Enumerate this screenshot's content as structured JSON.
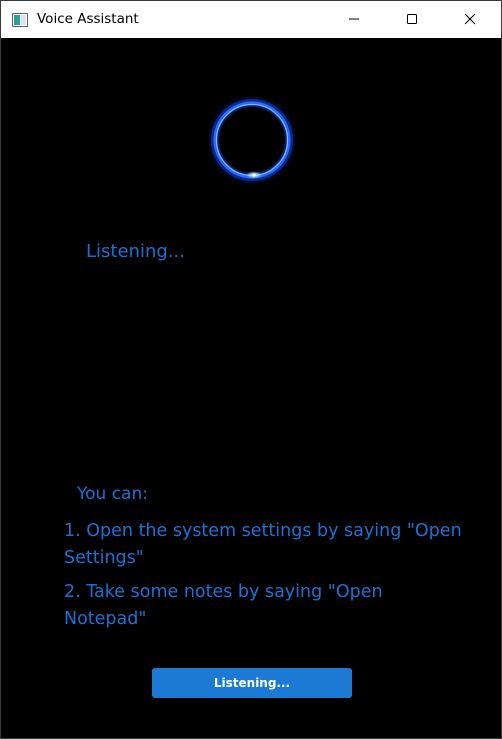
{
  "window": {
    "title": "Voice Assistant",
    "controls": {
      "minimize_icon": "minimize-icon",
      "maximize_icon": "maximize-icon",
      "close_icon": "close-icon"
    }
  },
  "assistant": {
    "status": "Listening...",
    "orb_icon": "listening-orb-icon",
    "accent_color": "#1a72d6"
  },
  "hints": {
    "title": "You can:",
    "items": [
      "1. Open the system settings by saying \"Open Settings\"",
      "2. Take some notes by saying \"Open Notepad\""
    ]
  },
  "button": {
    "label": "Listening...",
    "color": "#1c79d4"
  }
}
